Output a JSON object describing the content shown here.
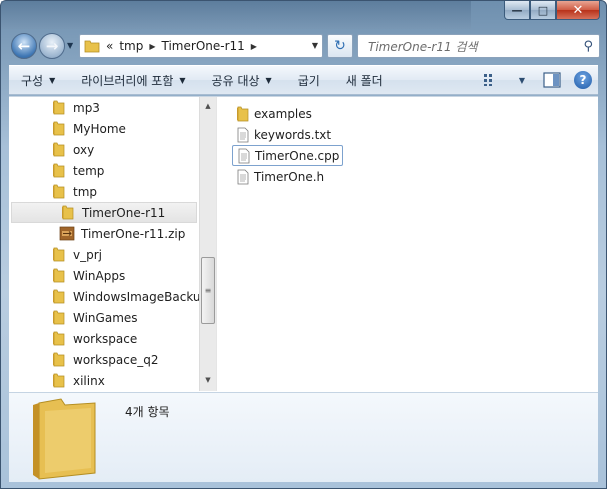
{
  "window": {
    "caption_min": "—",
    "caption_max": "□",
    "caption_close": "✕"
  },
  "address_bar": {
    "overflow": "«",
    "crumbs": [
      "tmp",
      "TimerOne-r11"
    ]
  },
  "search": {
    "placeholder": "TimerOne-r11 검색"
  },
  "toolbar": {
    "organize": "구성",
    "include_in_library": "라이브러리에 포함",
    "share_with": "공유 대상",
    "burn": "굽기",
    "new_folder": "새 폴더",
    "help": "?"
  },
  "nav_tree": {
    "items": [
      {
        "label": "mp3",
        "icon": "folder-icon"
      },
      {
        "label": "MyHome",
        "icon": "folder-icon"
      },
      {
        "label": "oxy",
        "icon": "folder-icon"
      },
      {
        "label": "temp",
        "icon": "folder-icon"
      },
      {
        "label": "tmp",
        "icon": "folder-icon"
      },
      {
        "label": "TimerOne-r11",
        "icon": "folder-icon",
        "selected": true
      },
      {
        "label": "TimerOne-r11.zip",
        "icon": "zip-icon"
      },
      {
        "label": "v_prj",
        "icon": "folder-icon"
      },
      {
        "label": "WinApps",
        "icon": "folder-icon"
      },
      {
        "label": "WindowsImageBackup",
        "icon": "folder-icon"
      },
      {
        "label": "WinGames",
        "icon": "folder-icon"
      },
      {
        "label": "workspace",
        "icon": "folder-icon"
      },
      {
        "label": "workspace_q2",
        "icon": "folder-icon"
      },
      {
        "label": "xilinx",
        "icon": "folder-icon"
      }
    ]
  },
  "files": {
    "items": [
      {
        "label": "examples",
        "icon": "folder-icon"
      },
      {
        "label": "keywords.txt",
        "icon": "text-file-icon"
      },
      {
        "label": "TimerOne.cpp",
        "icon": "text-file-icon",
        "focused": true
      },
      {
        "label": "TimerOne.h",
        "icon": "text-file-icon"
      }
    ]
  },
  "details": {
    "item_count": "4개 항목"
  },
  "colors": {
    "folder": "#e8c14a",
    "selection_border": "#7da2ce",
    "frame": "#a7c0d8"
  }
}
